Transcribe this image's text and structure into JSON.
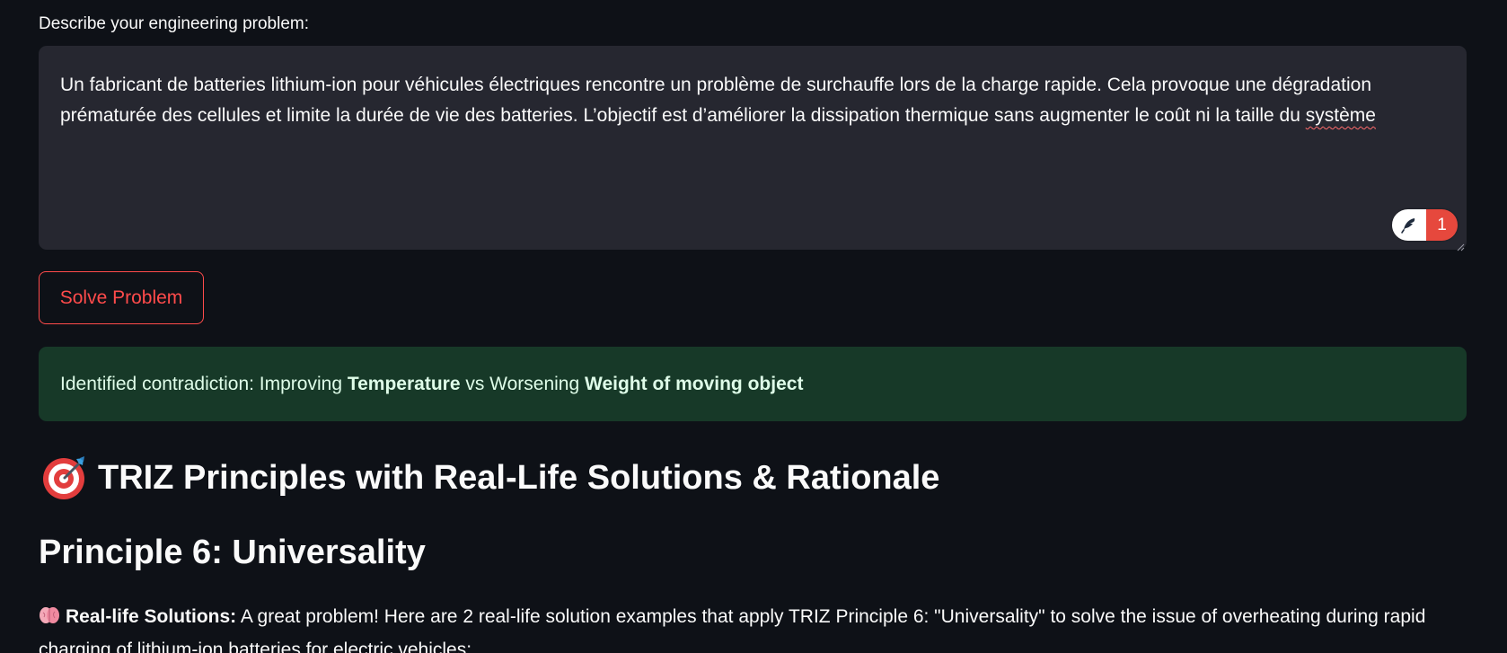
{
  "form": {
    "label": "Describe your engineering problem:",
    "problem_text_main": "Un fabricant de batteries lithium-ion pour véhicules électriques rencontre un problème de surchauffe lors de la charge rapide. Cela provoque une dégradation prématurée des cellules et limite la durée de vie des batteries. L’objectif est d’améliorer la dissipation thermique sans augmenter le coût ni la taille du ",
    "problem_text_flagged_word": "système",
    "grammar_count": "1",
    "solve_button_label": "Solve Problem"
  },
  "result": {
    "contradiction_prefix": "Identified contradiction: Improving ",
    "improving_param": "Temperature",
    "contradiction_middle": " vs Worsening ",
    "worsening_param": "Weight of moving object"
  },
  "content": {
    "section_title": "TRIZ Principles with Real-Life Solutions & Rationale",
    "section_icon": "target-icon",
    "principle_title": "Principle 6: Universality",
    "solutions_icon": "brain-icon",
    "solutions_label": "Real-life Solutions:",
    "solutions_text": " A great problem! Here are 2 real-life solution examples that apply TRIZ Principle 6: \"Universality\" to solve the issue of overheating during rapid charging of lithium-ion batteries for electric vehicles:"
  },
  "colors": {
    "background": "#0e1117",
    "textarea_bg": "#262730",
    "accent_red": "#ff4b4b",
    "success_bg": "#173928",
    "success_text": "#dffde9"
  }
}
